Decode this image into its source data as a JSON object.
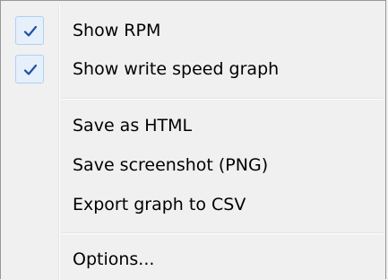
{
  "menu": {
    "items": [
      {
        "label": "Show RPM",
        "checked": true,
        "check_icon": "checkmark-icon"
      },
      {
        "label": "Show write speed graph",
        "checked": true,
        "check_icon": "checkmark-icon"
      },
      {
        "label": "Save as HTML"
      },
      {
        "label": "Save screenshot (PNG)"
      },
      {
        "label": "Export graph to CSV"
      },
      {
        "label": "Options..."
      }
    ]
  },
  "colors": {
    "check": "#1f4fa8",
    "checkbox_fill": "#e6f0fa",
    "checkbox_border": "#aecff7",
    "menu_background": "#f0f0f0"
  }
}
